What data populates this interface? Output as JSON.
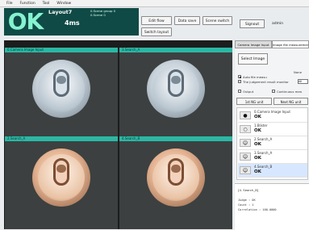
{
  "menu": [
    "File",
    "Function",
    "Tool",
    "Window"
  ],
  "judgement": "OK",
  "layout_name": "Layout7",
  "scene_group": "0.Scene group 0",
  "scene": "0.Scene 0",
  "time": "4ms",
  "toolbar": {
    "edit_flow": "Edit flow",
    "data_save": "Data save",
    "scene_switch": "Scene switch",
    "switch_layout": "Switch layout"
  },
  "user": {
    "signout": "Signout",
    "name": "admin"
  },
  "panes": [
    {
      "title": "0.Camera Image Input",
      "tone": "silver"
    },
    {
      "title": "3.Search_A",
      "tone": "silver"
    },
    {
      "title": "2.Search_A",
      "tone": "bronze"
    },
    {
      "title": "4.Search_B",
      "tone": "bronze"
    }
  ],
  "right": {
    "tab1": "Camera Image Input",
    "tab2": "Image file measurement",
    "select_image": "Select Image",
    "none": "None",
    "auto_file_measure": "Auto file measu",
    "judge_result_label": "The judgement result monitor",
    "dd_value": "All",
    "output": "Output",
    "continuous": "Continuous mea",
    "first_ng": "1st NG unit",
    "next_ng": "Next NG unit"
  },
  "flow": [
    {
      "name": "0.Camera Image Input",
      "status": "OK",
      "icon": "camera-icon"
    },
    {
      "name": "1.Blister",
      "status": "OK",
      "icon": "glasses-icon"
    },
    {
      "name": "2.Search_A",
      "status": "OK",
      "icon": "search-icon"
    },
    {
      "name": "3.Search_A",
      "status": "OK",
      "icon": "search-icon"
    },
    {
      "name": "4.Search_B",
      "status": "OK",
      "icon": "search-icon"
    }
  ],
  "detail": {
    "title": "[4. Search_B]",
    "status": "OK",
    "lines": [
      "Judge   : OK",
      "Count   : 1",
      "Correlation : 100.0000"
    ]
  }
}
